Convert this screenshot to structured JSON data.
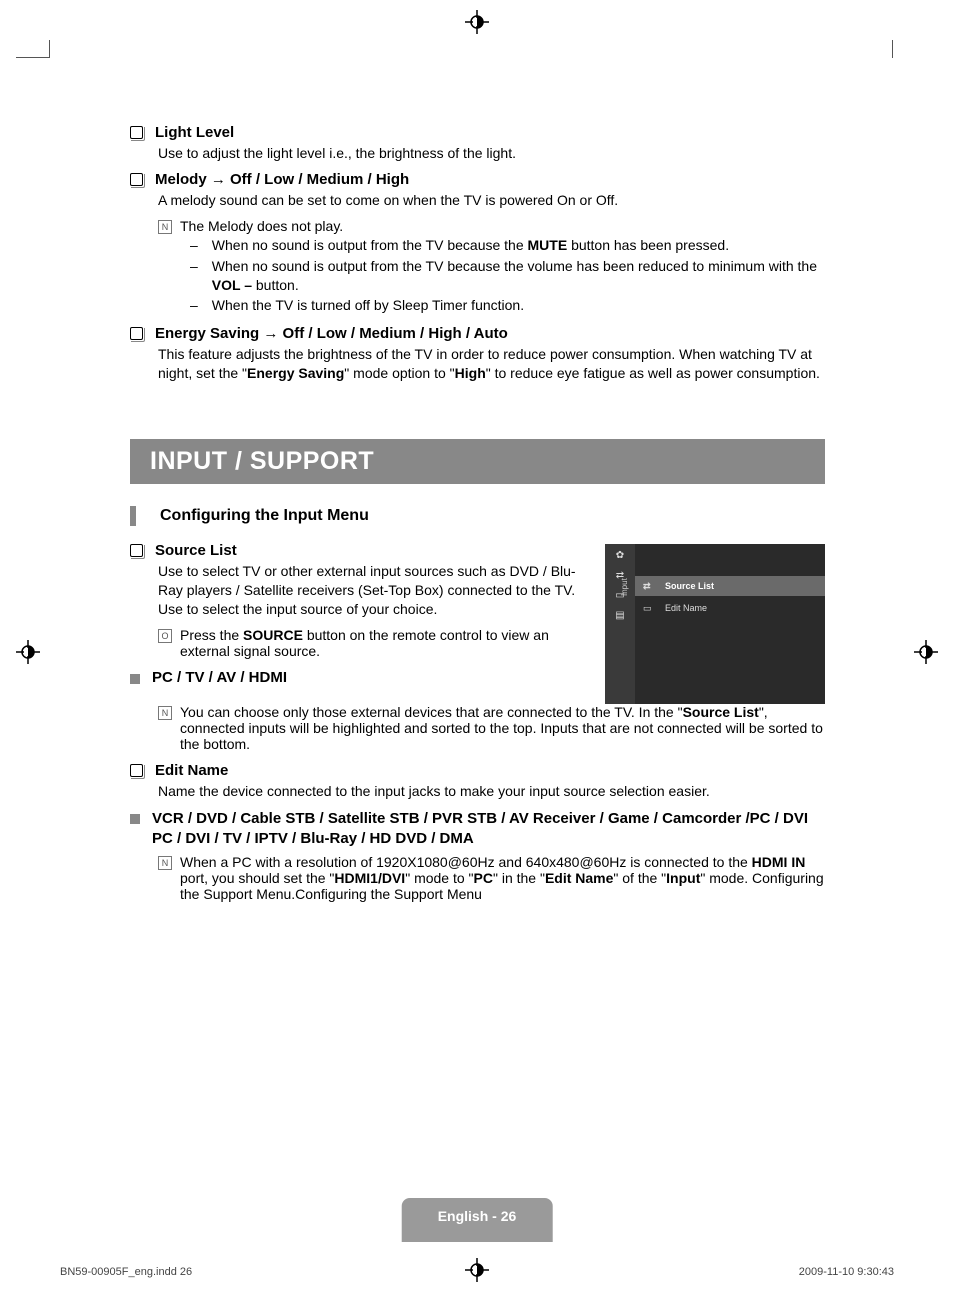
{
  "sections": {
    "light_level": {
      "title": "Light Level",
      "desc": "Use to adjust the light level i.e., the brightness of the light."
    },
    "melody": {
      "title": "Melody → Off / Low / Medium / High",
      "desc": "A melody sound can be set to come on when the TV is powered On or Off.",
      "note": "The Melody does not play.",
      "dash1_pre": "When no sound is output from the TV because the ",
      "dash1_bold": "MUTE",
      "dash1_post": " button has been pressed.",
      "dash2_pre": "When no sound is output from the TV because the volume has been reduced to minimum with the ",
      "dash2_bold": "VOL –",
      "dash2_post": " button.",
      "dash3": "When the TV is turned off by Sleep Timer function."
    },
    "energy": {
      "title": "Energy Saving → Off / Low / Medium / High / Auto",
      "desc_pre": "This feature adjusts the brightness of the TV in order to reduce power consumption. When watching TV at night, set the \"",
      "desc_b1": "Energy Saving",
      "desc_mid": "\" mode option to \"",
      "desc_b2": "High",
      "desc_post": "\" to reduce eye fatigue as well as power consumption."
    }
  },
  "banner": "INPUT / SUPPORT",
  "subsection": "Configuring the Input Menu",
  "source_list": {
    "title": "Source List",
    "desc": "Use to select TV or other external input sources such as DVD / Blu-Ray players / Satellite receivers (Set-Top Box) connected to the TV. Use to select the input source of your choice.",
    "note_pre": "Press the ",
    "note_bold": "SOURCE",
    "note_post": " button on the remote control to view an external signal source."
  },
  "pc_tv": {
    "title": "PC / TV / AV / HDMI",
    "note_pre": "You can choose only those external devices that are connected to the TV. In the \"",
    "note_b": "Source List",
    "note_post": "\", connected inputs will be highlighted and sorted to the top. Inputs that are not connected will be sorted to the bottom."
  },
  "edit_name": {
    "title": "Edit Name",
    "desc": "Name the device connected to the input jacks to make your input source selection easier."
  },
  "vcr": {
    "title": "VCR / DVD / Cable STB / Satellite STB / PVR STB / AV Receiver / Game / Camcorder /PC / DVI PC / DVI / TV / IPTV / Blu-Ray / HD DVD / DMA",
    "note_pre": "When a PC with a resolution of 1920X1080@60Hz and 640x480@60Hz is connected to the ",
    "note_b1": "HDMI IN",
    "note_mid1": " port, you should set the \"",
    "note_b2": "HDMI1/DVI",
    "note_mid2": "\" mode to \"",
    "note_b3": "PC",
    "note_mid3": "\" in the \"",
    "note_b4": "Edit Name",
    "note_mid4": "\" of the \"",
    "note_b5": "Input",
    "note_post": "\" mode. Configuring the Support Menu.Configuring the Support Menu"
  },
  "osd": {
    "tab": "Input",
    "row1": "Source List",
    "row2": "Edit Name"
  },
  "footer": {
    "page": "English - 26",
    "file": "BN59-00905F_eng.indd   26",
    "timestamp": "2009-11-10   9:30:43"
  }
}
